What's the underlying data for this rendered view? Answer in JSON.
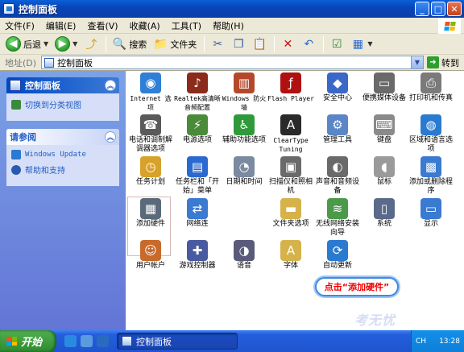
{
  "window": {
    "title": "控制面板"
  },
  "menu": [
    "文件(F)",
    "编辑(E)",
    "查看(V)",
    "收藏(A)",
    "工具(T)",
    "帮助(H)"
  ],
  "toolbar": {
    "back": "后退",
    "search": "搜索",
    "folders": "文件夹"
  },
  "address": {
    "label": "地址(D)",
    "value": "控制面板",
    "go": "转到"
  },
  "sidebar": {
    "panel1": {
      "title": "控制面板",
      "link": "切换到分类视图"
    },
    "panel2": {
      "title": "请参阅",
      "links": [
        "Windows Update",
        "帮助和支持"
      ]
    }
  },
  "items": [
    {
      "label": "Internet 选项",
      "icon": "internet-options-icon",
      "color": "#2f7fd6"
    },
    {
      "label": "Realtek高清晰音频配置",
      "icon": "speaker-icon",
      "color": "#8b2b1b"
    },
    {
      "label": "Windows 防火墙",
      "icon": "firewall-icon",
      "color": "#b5482a"
    },
    {
      "label": "Flash Player",
      "icon": "flash-icon",
      "color": "#b01010"
    },
    {
      "label": "安全中心",
      "icon": "shield-icon",
      "color": "#3a68c8"
    },
    {
      "label": "便携媒体设备",
      "icon": "media-device-icon",
      "color": "#6a6a6a"
    },
    {
      "label": "打印机和传真",
      "icon": "printer-icon",
      "color": "#7a7a7a"
    },
    {
      "label": "电话和调制解调器选项",
      "icon": "phone-icon",
      "color": "#5a5a5a"
    },
    {
      "label": "电源选项",
      "icon": "power-icon",
      "color": "#4a8b3a"
    },
    {
      "label": "辅助功能选项",
      "icon": "accessibility-icon",
      "color": "#2e9a3a"
    },
    {
      "label": "ClearType Tuning",
      "icon": "cleartype-icon",
      "color": "#2a2a2a"
    },
    {
      "label": "管理工具",
      "icon": "admin-tools-icon",
      "color": "#5a86c8"
    },
    {
      "label": "键盘",
      "icon": "keyboard-icon",
      "color": "#8a8a8a"
    },
    {
      "label": "区域和语言选项",
      "icon": "globe-icon",
      "color": "#2a7ad0"
    },
    {
      "label": "任务计划",
      "icon": "scheduled-tasks-icon",
      "color": "#d6a22a"
    },
    {
      "label": "任务栏和「开始」菜单",
      "icon": "taskbar-icon",
      "color": "#2a6ad0"
    },
    {
      "label": "日期和时间",
      "icon": "clock-icon",
      "color": "#7a8aa0"
    },
    {
      "label": "扫描仪和照相机",
      "icon": "scanner-icon",
      "color": "#6a6a6a"
    },
    {
      "label": "声音和音频设备",
      "icon": "sound-icon",
      "color": "#6a6a6a"
    },
    {
      "label": "鼠标",
      "icon": "mouse-icon",
      "color": "#9a9a9a"
    },
    {
      "label": "添加或删除程序",
      "icon": "add-remove-icon",
      "color": "#3a7ad0"
    },
    {
      "label": "添加硬件",
      "icon": "add-hardware-icon",
      "color": "#5a6a7a"
    },
    {
      "label": "网络连",
      "icon": "network-icon",
      "color": "#3a7ad0"
    },
    {
      "label": "",
      "icon": "hidden-icon",
      "color": "#ffffff"
    },
    {
      "label": "文件夹选项",
      "icon": "folder-options-icon",
      "color": "#d6b24a"
    },
    {
      "label": "无线网络安装向导",
      "icon": "wireless-icon",
      "color": "#4a9a4a"
    },
    {
      "label": "系统",
      "icon": "system-icon",
      "color": "#5a6a8a"
    },
    {
      "label": "显示",
      "icon": "display-icon",
      "color": "#3a7ad0"
    },
    {
      "label": "用户帐户",
      "icon": "user-accounts-icon",
      "color": "#c86a2a"
    },
    {
      "label": "游戏控制器",
      "icon": "game-controller-icon",
      "color": "#4a5aa0"
    },
    {
      "label": "语音",
      "icon": "speech-icon",
      "color": "#5a5a7a"
    },
    {
      "label": "字体",
      "icon": "fonts-icon",
      "color": "#d6b24a"
    },
    {
      "label": "自动更新",
      "icon": "windows-update-icon",
      "color": "#2a7ad0"
    }
  ],
  "callout": "点击“添加硬件”",
  "watermark": "考无忧 Easykao",
  "taskbar": {
    "start": "开始",
    "task": "控制面板",
    "lang": "CH",
    "time": "13:28"
  },
  "colors": {
    "titlebar": "#0a5fd8",
    "sidebar": "#6f8fe0",
    "callout_text": "#ee0000"
  }
}
